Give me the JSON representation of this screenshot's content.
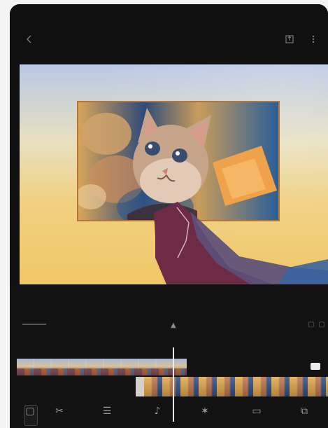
{
  "top_bar": {
    "back_icon": "arrow-left-icon",
    "export_icon": "export-icon",
    "more_icon": "more-icon"
  },
  "preview": {
    "background_top_color": "#b9c8e5",
    "background_bottom_color": "#f0c766",
    "overlay_border_color": "#b3773c"
  },
  "timeline": {
    "playhead_color": "#eaeaea"
  },
  "toolbar": {
    "tools": [
      {
        "name": "tool-1",
        "icon": "square-icon",
        "label": ""
      },
      {
        "name": "tool-2",
        "icon": "cut-icon",
        "label": ""
      },
      {
        "name": "tool-3",
        "icon": "layers-icon",
        "label": ""
      },
      {
        "name": "tool-4",
        "icon": "audio-icon",
        "label": ""
      },
      {
        "name": "tool-5",
        "icon": "effects-icon",
        "label": ""
      },
      {
        "name": "tool-6",
        "icon": "crop-icon",
        "label": ""
      },
      {
        "name": "tool-7",
        "icon": "more-tools-icon",
        "label": ""
      }
    ]
  }
}
